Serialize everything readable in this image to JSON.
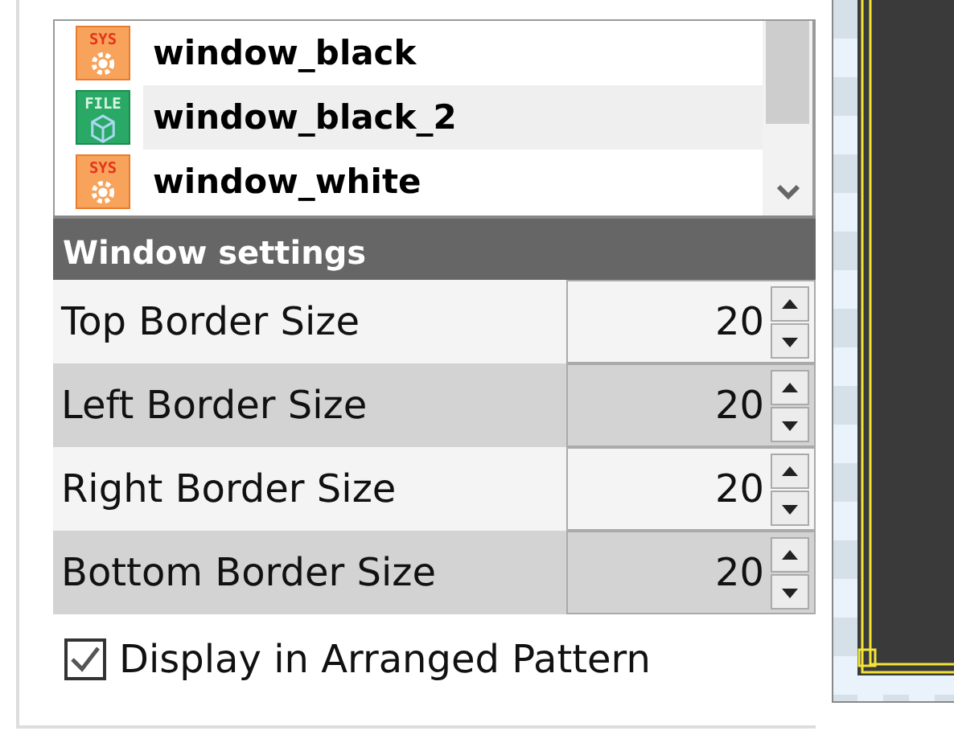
{
  "asset_list": {
    "items": [
      {
        "name": "window_black",
        "kind": "sys",
        "badge": "SYS",
        "selected": false
      },
      {
        "name": "window_black_2",
        "kind": "file",
        "badge": "FILE",
        "selected": true
      },
      {
        "name": "window_white",
        "kind": "sys",
        "badge": "SYS",
        "selected": false
      }
    ]
  },
  "settings": {
    "title": "Window settings",
    "rows": [
      {
        "label": "Top Border Size",
        "value": "20"
      },
      {
        "label": "Left Border Size",
        "value": "20"
      },
      {
        "label": "Right Border Size",
        "value": "20"
      },
      {
        "label": "Bottom Border Size",
        "value": "20"
      }
    ]
  },
  "arrange_checkbox": {
    "label": "Display in Arranged Pattern",
    "checked": true
  }
}
